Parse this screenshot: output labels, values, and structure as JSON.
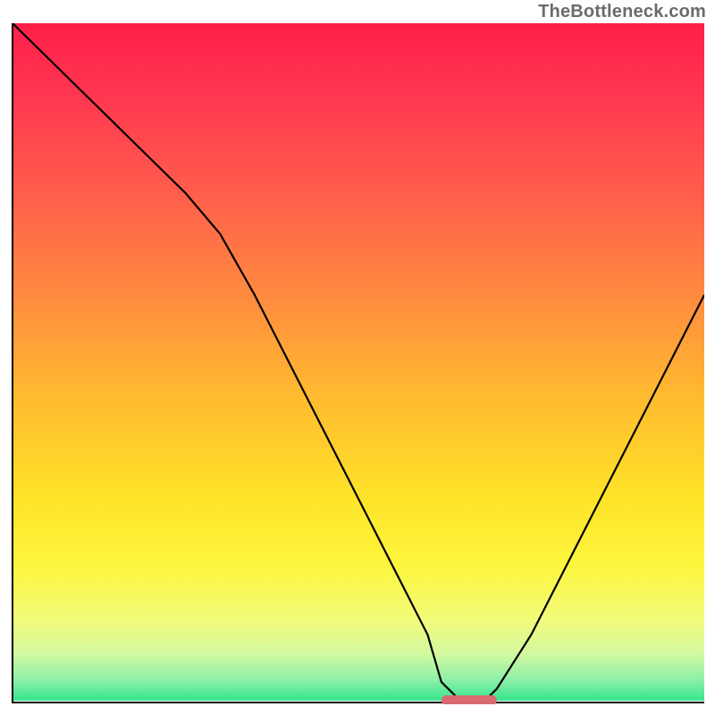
{
  "watermark": "TheBottleneck.com",
  "colors": {
    "gradient_stops": [
      {
        "offset": 0.0,
        "color": "#ff1f4a"
      },
      {
        "offset": 0.1,
        "color": "#ff3550"
      },
      {
        "offset": 0.25,
        "color": "#ff5d4c"
      },
      {
        "offset": 0.4,
        "color": "#ff8a3f"
      },
      {
        "offset": 0.55,
        "color": "#ffba2f"
      },
      {
        "offset": 0.7,
        "color": "#ffe328"
      },
      {
        "offset": 0.8,
        "color": "#fdf63e"
      },
      {
        "offset": 0.88,
        "color": "#f2fb7a"
      },
      {
        "offset": 0.93,
        "color": "#d4f9a0"
      },
      {
        "offset": 0.97,
        "color": "#8bf0a8"
      },
      {
        "offset": 1.0,
        "color": "#35e58e"
      }
    ],
    "marker": "#d86b6f",
    "band_left": "#fffef0",
    "band_right": "#eafcde"
  },
  "chart_data": {
    "type": "line",
    "title": "",
    "xlabel": "",
    "ylabel": "",
    "xlim": [
      0,
      100
    ],
    "ylim": [
      0,
      100
    ],
    "x": [
      0,
      5,
      10,
      15,
      20,
      25,
      30,
      35,
      40,
      45,
      50,
      55,
      60,
      62,
      65,
      68,
      70,
      75,
      80,
      85,
      90,
      95,
      100
    ],
    "values": [
      100,
      95,
      90,
      85,
      80,
      75,
      69,
      60,
      50,
      40,
      30,
      20,
      10,
      3,
      0,
      0,
      2,
      10,
      20,
      30,
      40,
      50,
      60
    ],
    "series": [
      {
        "name": "bottleneck-curve",
        "x": [
          0,
          5,
          10,
          15,
          20,
          25,
          30,
          35,
          40,
          45,
          50,
          55,
          60,
          62,
          65,
          68,
          70,
          75,
          80,
          85,
          90,
          95,
          100
        ],
        "values": [
          100,
          95,
          90,
          85,
          80,
          75,
          69,
          60,
          50,
          40,
          30,
          20,
          10,
          3,
          0,
          0,
          2,
          10,
          20,
          30,
          40,
          50,
          60
        ]
      }
    ],
    "marker": {
      "x_start": 62,
      "x_end": 70,
      "y": 0
    }
  }
}
